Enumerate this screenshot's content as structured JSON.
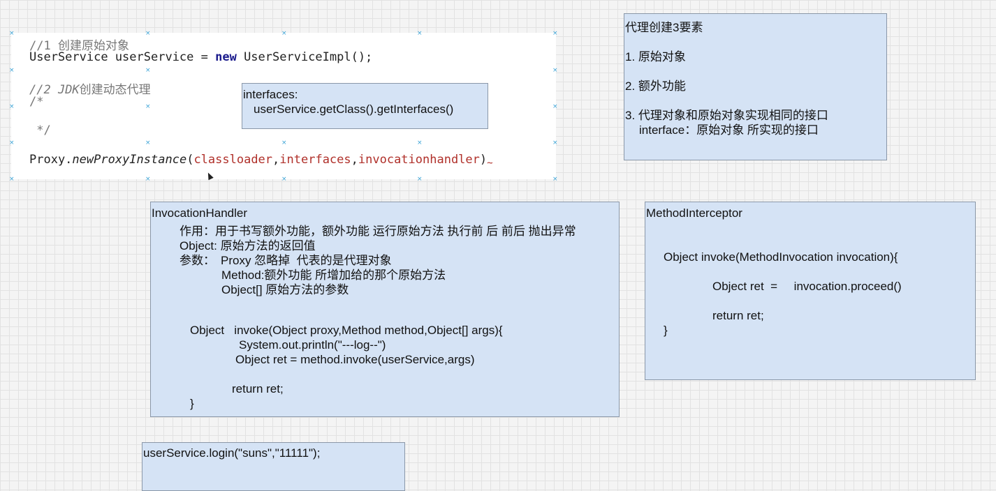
{
  "code": {
    "line1": "//1 创建原始对象",
    "line2_a": "UserService userService = ",
    "line2_kw": "new",
    "line2_b": " UserServiceImpl();",
    "line3_a": "//2 ",
    "line3_b": "JDK",
    "line3_c": "创建动态代理",
    "line4": "/*",
    "line5": " */",
    "line6_a": "Proxy.",
    "line6_method": "newProxyInstance",
    "line6_open": "(",
    "line6_p1": "classloader",
    "line6_c1": ",",
    "line6_p2": "interfaces",
    "line6_c2": ",",
    "line6_p3": "invocationhandler",
    "line6_close": ")",
    "line6_squiggle": "~"
  },
  "interfaces_box": {
    "line1": "interfaces:",
    "line2": "userService.getClass().getInterfaces()"
  },
  "elements_box": {
    "title": "代理创建3要素",
    "item1": "1. 原始对象",
    "item2": "2. 额外功能",
    "item3": "3. 代理对象和原始对象实现相同的接口",
    "item3_sub": "interface：原始对象 所实现的接口"
  },
  "handler_box": {
    "title": "InvocationHandler",
    "purpose": "作用：用于书写额外功能，额外功能 运行原始方法 执行前 后 前后 抛出异常",
    "return_desc": "Object: 原始方法的返回值",
    "params_label": "参数：",
    "param1": "Proxy 忽略掉  代表的是代理对象",
    "param2": "Method:额外功能 所增加给的那个原始方法",
    "param3": "Object[] 原始方法的参数",
    "sig": "Object   invoke(Object proxy,Method method,Object[] args){",
    "body1": "System.out.println(\"---log--\")",
    "body2": "Object ret = method.invoke(userService,args)",
    "body3": "return ret;",
    "close": "}"
  },
  "interceptor_box": {
    "title": "MethodInterceptor",
    "sig": "Object invoke(MethodInvocation invocation){",
    "body1": "Object ret  =     invocation.proceed()",
    "body2": "return ret;",
    "close": "}"
  },
  "login_box": {
    "line1": "userService.login(\"suns\",\"11111\");"
  },
  "colors": {
    "box_fill": "#d5e3f5",
    "box_border": "#8a97a8",
    "param_red": "#b0302a",
    "keyword_blue": "#1a1a8c",
    "selection_handle": "#3aa3d6"
  }
}
